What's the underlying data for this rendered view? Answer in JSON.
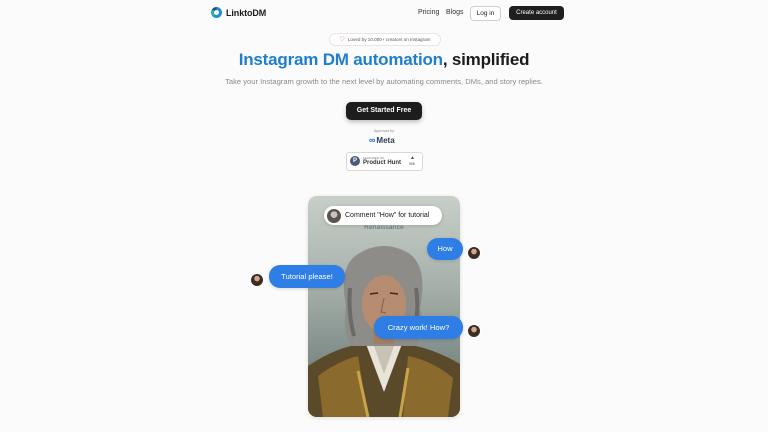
{
  "nav": {
    "brand": "LinktoDM",
    "links": [
      "Pricing",
      "Blogs"
    ],
    "login": "Log in",
    "create_account": "Create account"
  },
  "hero": {
    "badge": "Loved by 10,000+ creators on Instagram",
    "headline_accent": "Instagram DM automation",
    "headline_rest": ", simplified",
    "subtitle": "Take your Instagram growth to the next level by automating comments, DMs, and story replies.",
    "cta": "Get Started Free",
    "approved_by": "Approved by",
    "meta_label": "Meta",
    "product_hunt": {
      "featured_on": "FEATURED ON",
      "name": "Product Hunt",
      "votes": "905"
    }
  },
  "demo": {
    "card_caption": "Renaissance",
    "comment_pill": "Comment \"How\" for tutorial",
    "bubbles": {
      "how": "How",
      "tutorial": "Tutorial please!",
      "crazy": "Crazy work! How?"
    }
  },
  "colors": {
    "accent": "#1f7fc9",
    "bubble": "#2f7ee6",
    "dark_button": "#1d1d1d"
  },
  "icons": {
    "logo": "linktodm-logo-icon",
    "heart": "heart-icon",
    "meta": "meta-infinity-icon",
    "product_hunt": "product-hunt-icon",
    "upvote": "upvote-arrow-icon"
  }
}
